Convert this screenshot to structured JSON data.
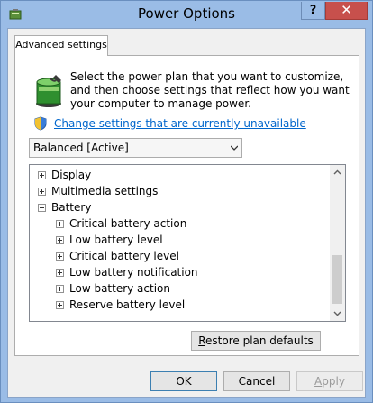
{
  "window": {
    "title": "Power Options",
    "help_label": "?",
    "close_label": "✕"
  },
  "tabs": [
    {
      "label": "Advanced settings",
      "selected": true
    }
  ],
  "description": "Select the power plan that you want to customize, and then choose settings that reflect how you want your computer to manage power.",
  "change_link": "Change settings that are currently unavailable",
  "plan_select": {
    "value": "Balanced [Active]"
  },
  "tree": {
    "items": [
      {
        "label": "Display",
        "expanded": false
      },
      {
        "label": "Multimedia settings",
        "expanded": false
      },
      {
        "label": "Battery",
        "expanded": true,
        "children": [
          {
            "label": "Critical battery action"
          },
          {
            "label": "Low battery level"
          },
          {
            "label": "Critical battery level"
          },
          {
            "label": "Low battery notification"
          },
          {
            "label": "Low battery action"
          },
          {
            "label": "Reserve battery level"
          }
        ]
      }
    ]
  },
  "buttons": {
    "restore": "Restore plan defaults",
    "ok": "OK",
    "cancel": "Cancel",
    "apply": "Apply"
  },
  "colors": {
    "title_bar": "#9abce6",
    "close_button": "#c7504c",
    "link": "#0066cc"
  },
  "icons": {
    "app": "power-options-icon",
    "battery": "battery-plug-icon",
    "shield": "uac-shield-icon"
  }
}
